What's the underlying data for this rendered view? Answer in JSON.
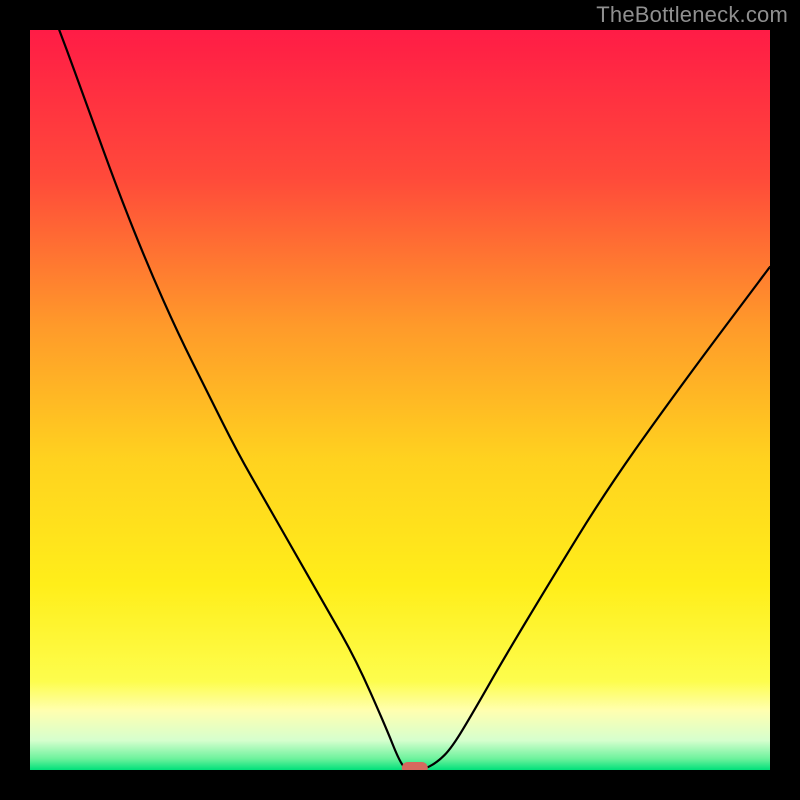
{
  "watermark": "TheBottleneck.com",
  "chart_data": {
    "type": "line",
    "title": "",
    "xlabel": "",
    "ylabel": "",
    "xlim": [
      0,
      100
    ],
    "ylim": [
      0,
      100
    ],
    "grid": false,
    "background_gradient": {
      "stops": [
        {
          "offset": 0.0,
          "color": "#ff1c46"
        },
        {
          "offset": 0.2,
          "color": "#ff4a3a"
        },
        {
          "offset": 0.4,
          "color": "#ff9a2a"
        },
        {
          "offset": 0.58,
          "color": "#ffd21f"
        },
        {
          "offset": 0.75,
          "color": "#ffee1a"
        },
        {
          "offset": 0.88,
          "color": "#fdfd4d"
        },
        {
          "offset": 0.92,
          "color": "#ffffb0"
        },
        {
          "offset": 0.96,
          "color": "#d6ffce"
        },
        {
          "offset": 0.985,
          "color": "#6cf29c"
        },
        {
          "offset": 1.0,
          "color": "#00e07a"
        }
      ]
    },
    "series": [
      {
        "name": "bottleneck-curve",
        "color": "#000000",
        "x": [
          0,
          4,
          8,
          12,
          16,
          20,
          24,
          28,
          32,
          36,
          40,
          44,
          48,
          50,
          51,
          52,
          53,
          55,
          57,
          60,
          64,
          70,
          78,
          88,
          100
        ],
        "y": [
          110,
          100,
          89,
          78,
          68,
          59,
          51,
          43,
          36,
          29,
          22,
          15,
          6,
          1,
          0,
          0,
          0,
          1,
          3,
          8,
          15,
          25,
          38,
          52,
          68
        ]
      }
    ],
    "marker": {
      "name": "optimal-point",
      "shape": "rounded-rect",
      "x": 52,
      "y": 0,
      "color": "#d6695e"
    }
  }
}
